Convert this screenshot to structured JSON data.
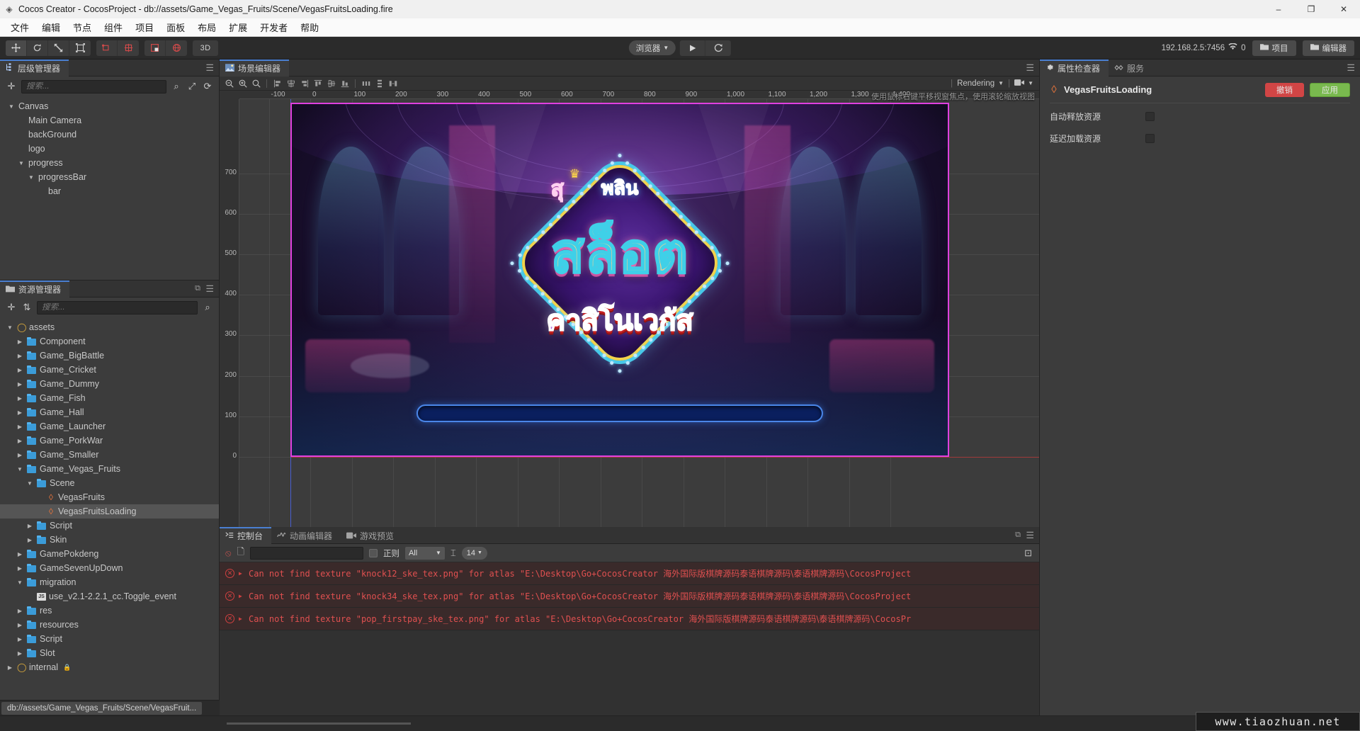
{
  "window": {
    "title": "Cocos Creator - CocosProject - db://assets/Game_Vegas_Fruits/Scene/VegasFruitsLoading.fire",
    "app_icon": "cocos-flame-icon",
    "minimize": "–",
    "maximize": "❐",
    "close": "✕"
  },
  "menubar": [
    "文件",
    "编辑",
    "节点",
    "组件",
    "项目",
    "面板",
    "布局",
    "扩展",
    "开发者",
    "帮助"
  ],
  "toolbar": {
    "transform_tools": [
      "move-tool",
      "rotate-tool",
      "scale-tool",
      "rect-tool"
    ],
    "pivot_tools": [
      "pivot-anchor-tool",
      "pivot-center-tool"
    ],
    "coord_tools": [
      "local-coord-tool",
      "global-coord-tool"
    ],
    "mode_3d": "3D",
    "preview_target": "浏览器",
    "play_label": "play-icon",
    "refresh_label": "refresh-icon",
    "ip_address": "192.168.2.5:7456",
    "wifi_icon": "wifi-icon",
    "device_count": "0",
    "project_button": "项目",
    "editor_button": "编辑器"
  },
  "hierarchy": {
    "tab_label": "层级管理器",
    "tab_icon": "hierarchy-icon",
    "add_icon": "plus-icon",
    "search_placeholder": "搜索...",
    "search_value": "",
    "icons": [
      "search-icon",
      "expand-icon",
      "refresh-icon"
    ],
    "nodes": [
      {
        "label": "Canvas",
        "depth": 0,
        "expanded": true,
        "has_children": true
      },
      {
        "label": "Main Camera",
        "depth": 1,
        "expanded": false,
        "has_children": false
      },
      {
        "label": "backGround",
        "depth": 1,
        "expanded": false,
        "has_children": false
      },
      {
        "label": "logo",
        "depth": 1,
        "expanded": false,
        "has_children": false
      },
      {
        "label": "progress",
        "depth": 1,
        "expanded": true,
        "has_children": true
      },
      {
        "label": "progressBar",
        "depth": 2,
        "expanded": true,
        "has_children": true
      },
      {
        "label": "bar",
        "depth": 3,
        "expanded": false,
        "has_children": false
      }
    ]
  },
  "assets": {
    "tab_label": "资源管理器",
    "tab_icon": "folder-icon",
    "add_icon": "plus-icon",
    "sort_icon": "sort-icon",
    "search_placeholder": "搜索...",
    "search_value": "",
    "search_icon": "search-icon",
    "copy_icon": "copy-icon",
    "items": [
      {
        "label": "assets",
        "depth": 0,
        "type": "root",
        "expanded": true,
        "selected": false
      },
      {
        "label": "Component",
        "depth": 1,
        "type": "folder",
        "expanded": false,
        "selected": false
      },
      {
        "label": "Game_BigBattle",
        "depth": 1,
        "type": "folder",
        "expanded": false,
        "selected": false
      },
      {
        "label": "Game_Cricket",
        "depth": 1,
        "type": "folder",
        "expanded": false,
        "selected": false
      },
      {
        "label": "Game_Dummy",
        "depth": 1,
        "type": "folder",
        "expanded": false,
        "selected": false
      },
      {
        "label": "Game_Fish",
        "depth": 1,
        "type": "folder",
        "expanded": false,
        "selected": false
      },
      {
        "label": "Game_Hall",
        "depth": 1,
        "type": "folder",
        "expanded": false,
        "selected": false
      },
      {
        "label": "Game_Launcher",
        "depth": 1,
        "type": "folder",
        "expanded": false,
        "selected": false
      },
      {
        "label": "Game_PorkWar",
        "depth": 1,
        "type": "folder",
        "expanded": false,
        "selected": false
      },
      {
        "label": "Game_Smaller",
        "depth": 1,
        "type": "folder",
        "expanded": false,
        "selected": false
      },
      {
        "label": "Game_Vegas_Fruits",
        "depth": 1,
        "type": "folder",
        "expanded": true,
        "selected": false
      },
      {
        "label": "Scene",
        "depth": 2,
        "type": "folder",
        "expanded": true,
        "selected": false
      },
      {
        "label": "VegasFruits",
        "depth": 3,
        "type": "scene",
        "expanded": false,
        "selected": false
      },
      {
        "label": "VegasFruitsLoading",
        "depth": 3,
        "type": "scene",
        "expanded": false,
        "selected": true
      },
      {
        "label": "Script",
        "depth": 2,
        "type": "folder",
        "expanded": false,
        "selected": false
      },
      {
        "label": "Skin",
        "depth": 2,
        "type": "folder",
        "expanded": false,
        "selected": false
      },
      {
        "label": "GamePokdeng",
        "depth": 1,
        "type": "folder",
        "expanded": false,
        "selected": false
      },
      {
        "label": "GameSevenUpDown",
        "depth": 1,
        "type": "folder",
        "expanded": false,
        "selected": false
      },
      {
        "label": "migration",
        "depth": 1,
        "type": "folder",
        "expanded": true,
        "selected": false
      },
      {
        "label": "use_v2.1-2.2.1_cc.Toggle_event",
        "depth": 2,
        "type": "js",
        "expanded": false,
        "selected": false
      },
      {
        "label": "res",
        "depth": 1,
        "type": "folder",
        "expanded": false,
        "selected": false
      },
      {
        "label": "resources",
        "depth": 1,
        "type": "folder",
        "expanded": false,
        "selected": false
      },
      {
        "label": "Script",
        "depth": 1,
        "type": "folder",
        "expanded": false,
        "selected": false
      },
      {
        "label": "Slot",
        "depth": 1,
        "type": "folder",
        "expanded": false,
        "selected": false
      },
      {
        "label": "internal",
        "depth": 0,
        "type": "root-locked",
        "expanded": false,
        "selected": false
      }
    ]
  },
  "scene": {
    "tab_label": "场景编辑器",
    "tab_icon": "scene-icon",
    "zoom_tools": [
      "zoom-out-icon",
      "zoom-in-icon",
      "zoom-reset-icon"
    ],
    "align_tools": [
      "align-left-icon",
      "align-center-h-icon",
      "align-right-icon",
      "align-top-icon",
      "align-middle-v-icon",
      "align-bottom-icon"
    ],
    "distribute_tools": [
      "distribute-h-icon",
      "distribute-v-icon",
      "distribute-gap-icon"
    ],
    "rendering_label": "Rendering",
    "camera_icon": "camera-icon",
    "hint": "使用鼠标右键平移视窗焦点，使用滚轮缩放视图",
    "ruler_x": [
      "-100",
      "0",
      "100",
      "200",
      "300",
      "400",
      "500",
      "600",
      "700",
      "800",
      "900",
      "1,000",
      "1,100",
      "1,200",
      "1,300",
      "1,400"
    ],
    "ruler_y": [
      "700",
      "600",
      "500",
      "400",
      "300",
      "200",
      "100",
      "0"
    ],
    "logo": {
      "top_thai": "พลิน",
      "pink_thai": "สุ",
      "main_thai": "สล็อต",
      "bottom_thai": "คาสิโนเวกัส",
      "crown_icon": "crown-icon"
    }
  },
  "console": {
    "tabs": [
      {
        "label": "控制台",
        "icon": "console-icon",
        "active": true
      },
      {
        "label": "动画编辑器",
        "icon": "animation-icon",
        "active": false
      },
      {
        "label": "游戏预览",
        "icon": "preview-icon",
        "active": false
      }
    ],
    "clear_icon": "clear-icon",
    "copy_icon": "copy-icon",
    "filter_value": "",
    "regex_label": "正则",
    "regex_checked": false,
    "level_filter": "All",
    "font_icon": "font-size-icon",
    "font_size": "14",
    "collapse_icon": "collapse-icon",
    "messages": [
      {
        "level": "error",
        "text_en_1": "Can not find texture \"knock12_ske_tex.png\" for atlas \"E:\\Desktop\\Go+CocosCreator",
        "text_cn": "海外国际版棋牌源码泰语棋牌源码\\泰语棋牌源码",
        "text_en_2": "\\CocosProject"
      },
      {
        "level": "error",
        "text_en_1": "Can not find texture \"knock34_ske_tex.png\" for atlas \"E:\\Desktop\\Go+CocosCreator",
        "text_cn": "海外国际版棋牌源码泰语棋牌源码\\泰语棋牌源码",
        "text_en_2": "\\CocosProject"
      },
      {
        "level": "error",
        "text_en_1": "Can not find texture \"pop_firstpay_ske_tex.png\" for atlas \"E:\\Desktop\\Go+CocosCreator",
        "text_cn": "海外国际版棋牌源码泰语棋牌源码\\泰语棋牌源码",
        "text_en_2": "\\CocosPr"
      }
    ]
  },
  "inspector": {
    "tabs": [
      {
        "label": "属性检查器",
        "icon": "gear-icon",
        "active": true
      },
      {
        "label": "服务",
        "icon": "service-icon",
        "active": false
      }
    ],
    "asset_icon": "scene-flame-icon",
    "asset_name": "VegasFruitsLoading",
    "revert_button": "撤销",
    "apply_button": "应用",
    "properties": [
      {
        "label": "自动释放资源",
        "type": "checkbox",
        "checked": false
      },
      {
        "label": "延迟加载资源",
        "type": "checkbox",
        "checked": false
      }
    ]
  },
  "statusbar": {
    "path": "db://assets/Game_Vegas_Fruits/Scene/VegasFruit...",
    "icons": [
      "sync-icon",
      "database-icon",
      "eye-icon"
    ],
    "watermark": "www.tiaozhuan.net"
  },
  "colors": {
    "accent_blue": "#4a7fd1",
    "selection": "#555555",
    "error_red": "#e05050",
    "apply_green": "#79b94e",
    "revert_red": "#d14545",
    "canvas_border": "#e040e0",
    "folder_blue": "#3b9cd9"
  }
}
